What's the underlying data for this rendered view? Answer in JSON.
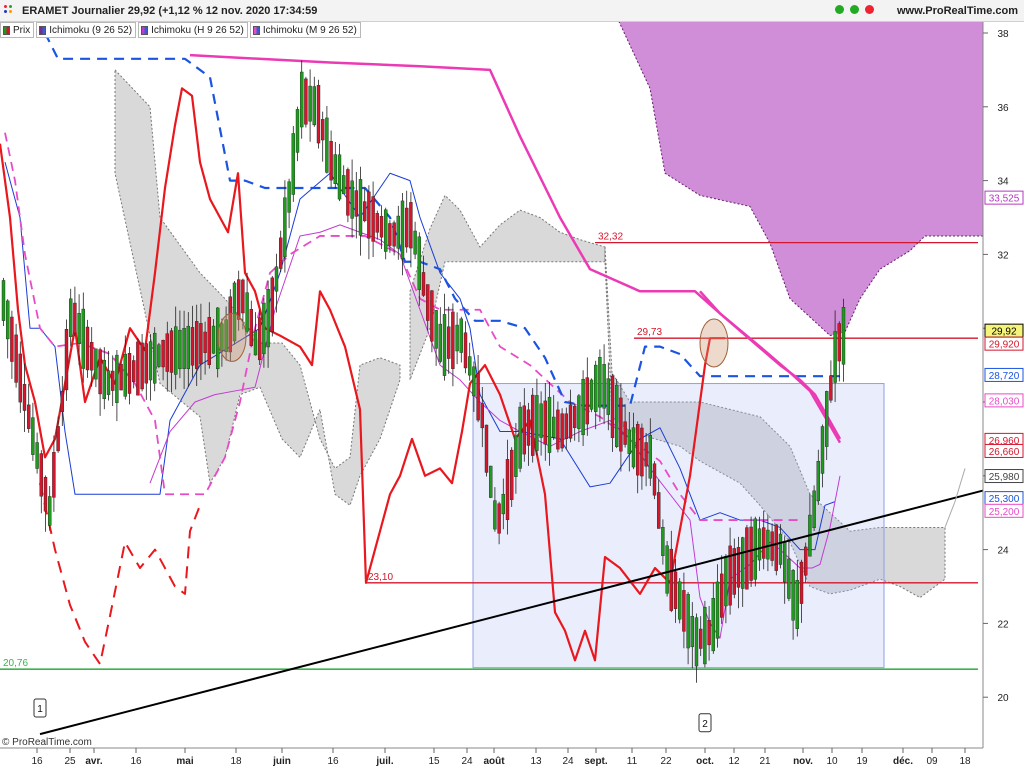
{
  "header": {
    "title": "ERAMET Journalier 29,92 (+1,12 % 12 nov. 2020 17:34:59",
    "site": "www.ProRealTime.com"
  },
  "legend": [
    {
      "label": "Prix",
      "color": "#1f9a1f"
    },
    {
      "label": "Ichimoku (9 26 52)",
      "color": "#7a2c8a"
    },
    {
      "label": "Ichimoku (H 9 26 52)",
      "color": "#c23bd1"
    },
    {
      "label": "Ichimoku (M 9 26 52)",
      "color": "#3b5bd1"
    }
  ],
  "copyright": "© ProRealTime.com",
  "colors": {
    "up": "#1f9a1f",
    "down": "#d4162c",
    "kijun_daily": "#1a54e0",
    "tenkan": "#1a3cd4",
    "kijun_h": "#e84bc8",
    "chikou": "#e8181e",
    "cloud_gray": "#d9d9d9",
    "cloud_violet": "#d08ed8",
    "support_green": "#39b54a",
    "hline_red": "#d4162c",
    "trendline": "#000000"
  },
  "chart_data": {
    "type": "candlestick",
    "title": "ERAMET Journalier",
    "y_ticks": [
      "38",
      "36",
      "34",
      "32",
      "30",
      "28",
      "26",
      "24",
      "22",
      "20"
    ],
    "x_ticks": [
      "16",
      "25",
      "avr.",
      "16",
      "mai",
      "18",
      "juin",
      "16",
      "juil.",
      "15",
      "24",
      "août",
      "13",
      "24",
      "sept.",
      "11",
      "22",
      "oct.",
      "12",
      "21",
      "nov.",
      "10",
      "19",
      "déc.",
      "09",
      "18"
    ],
    "levels": [
      {
        "label": "32,32",
        "value": 32.32,
        "color": "#d4162c"
      },
      {
        "label": "29,73",
        "value": 29.73,
        "color": "#d4162c"
      },
      {
        "label": "23,10",
        "value": 23.1,
        "color": "#d4162c"
      },
      {
        "label": "20,76",
        "value": 20.76,
        "color": "#39b54a"
      }
    ],
    "price_axis_labels": [
      {
        "label": "33,525",
        "value": 33.525,
        "color": "#b33ac0"
      },
      {
        "label": "29,92",
        "value": 29.92,
        "color": "#000000",
        "bg": "#f4f47a"
      },
      {
        "label": "29,920",
        "value": 29.92,
        "color": "#d4162c"
      },
      {
        "label": "28,720",
        "value": 28.72,
        "color": "#1a54e0"
      },
      {
        "label": "28,030",
        "value": 28.03,
        "color": "#e84bc8"
      },
      {
        "label": "26,960",
        "value": 26.96,
        "color": "#d4162c"
      },
      {
        "label": "26,660",
        "value": 26.66,
        "color": "#d4162c"
      },
      {
        "label": "25,980",
        "value": 25.98,
        "color": "#444444"
      },
      {
        "label": "25,300",
        "value": 25.3,
        "color": "#1a54e0"
      },
      {
        "label": "25,200",
        "value": 25.2,
        "color": "#e84bc8"
      }
    ],
    "annotations": [
      "1",
      "2"
    ],
    "last_price": 29.92,
    "change_pct": 1.12
  }
}
